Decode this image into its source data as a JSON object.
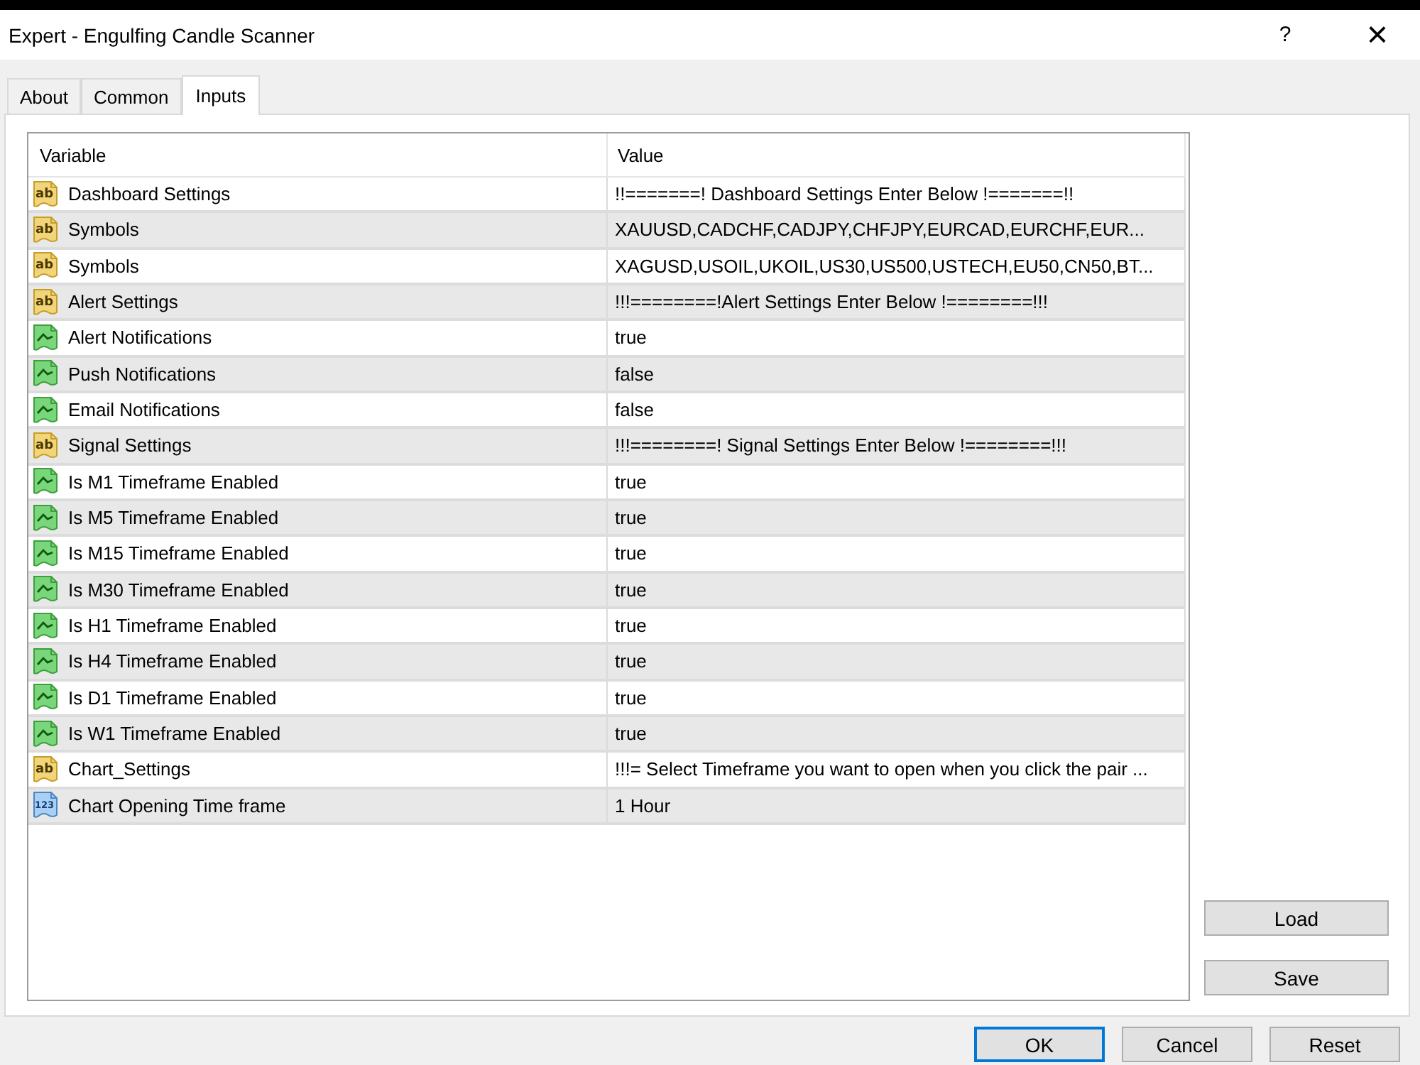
{
  "window": {
    "title": "Expert - Engulfing Candle Scanner",
    "help_button": "?",
    "close_button": "×"
  },
  "tabs": [
    {
      "label": "About",
      "selected": false
    },
    {
      "label": "Common",
      "selected": false
    },
    {
      "label": "Inputs",
      "selected": true
    }
  ],
  "inputs_table": {
    "columns": [
      "Variable",
      "Value"
    ],
    "rows": [
      {
        "kind": "string",
        "icon_label": "ab",
        "variable": "Dashboard Settings",
        "value": "!!=======! Dashboard Settings Enter Below !=======!!"
      },
      {
        "kind": "string",
        "icon_label": "ab",
        "variable": "Symbols",
        "value": "XAUUSD,CADCHF,CADJPY,CHFJPY,EURCAD,EURCHF,EUR..."
      },
      {
        "kind": "string",
        "icon_label": "ab",
        "variable": "Symbols",
        "value": "XAGUSD,USOIL,UKOIL,US30,US500,USTECH,EU50,CN50,BT..."
      },
      {
        "kind": "string",
        "icon_label": "ab",
        "variable": "Alert Settings",
        "value": "!!!========!Alert Settings Enter Below !========!!!"
      },
      {
        "kind": "bool",
        "variable": "Alert Notifications",
        "value": "true"
      },
      {
        "kind": "bool",
        "variable": "Push Notifications",
        "value": "false"
      },
      {
        "kind": "bool",
        "variable": "Email Notifications",
        "value": "false"
      },
      {
        "kind": "string",
        "icon_label": "ab",
        "variable": "Signal Settings",
        "value": "!!!========! Signal Settings Enter Below !========!!!"
      },
      {
        "kind": "bool",
        "variable": "Is M1 Timeframe Enabled",
        "value": "true"
      },
      {
        "kind": "bool",
        "variable": "Is M5 Timeframe Enabled",
        "value": "true"
      },
      {
        "kind": "bool",
        "variable": "Is M15 Timeframe Enabled",
        "value": "true"
      },
      {
        "kind": "bool",
        "variable": "Is M30 Timeframe Enabled",
        "value": "true"
      },
      {
        "kind": "bool",
        "variable": "Is H1 Timeframe Enabled",
        "value": "true"
      },
      {
        "kind": "bool",
        "variable": "Is H4 Timeframe Enabled",
        "value": "true"
      },
      {
        "kind": "bool",
        "variable": "Is D1 Timeframe Enabled",
        "value": "true"
      },
      {
        "kind": "bool",
        "variable": "Is W1 Timeframe Enabled",
        "value": "true"
      },
      {
        "kind": "string",
        "icon_label": "ab",
        "variable": "Chart_Settings",
        "value": "!!!= Select Timeframe you want to open when you click the pair ..."
      },
      {
        "kind": "number",
        "icon_label": "123",
        "variable": "Chart Opening Time frame",
        "value": "1 Hour"
      }
    ]
  },
  "side_buttons": [
    "Load",
    "Save"
  ],
  "buttons": [
    {
      "label": "OK",
      "focused": true
    },
    {
      "label": "Cancel",
      "focused": false
    },
    {
      "label": "Reset",
      "focused": false
    }
  ]
}
